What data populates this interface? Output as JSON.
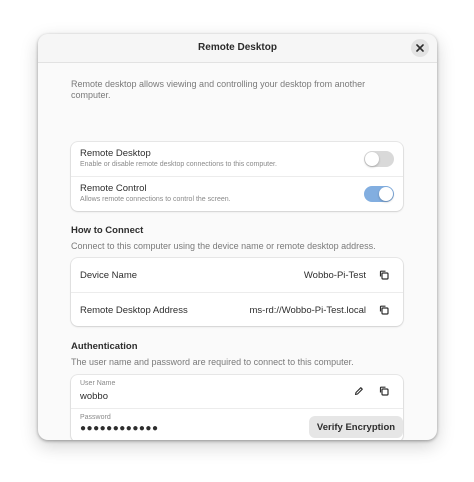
{
  "window": {
    "title": "Remote Desktop"
  },
  "intro": "Remote desktop allows viewing and controlling your desktop from another computer.",
  "toggles": {
    "remote_desktop": {
      "title": "Remote Desktop",
      "subtitle": "Enable or disable remote desktop connections to this computer.",
      "state": "off"
    },
    "remote_control": {
      "title": "Remote Control",
      "subtitle": "Allows remote connections to control the screen.",
      "state": "on"
    }
  },
  "connect": {
    "heading": "How to Connect",
    "description": "Connect to this computer using the device name or remote desktop address.",
    "device_name_label": "Device Name",
    "device_name_value": "Wobbo-Pi-Test",
    "address_label": "Remote Desktop Address",
    "address_value": "ms-rd://Wobbo-Pi-Test.local"
  },
  "auth": {
    "heading": "Authentication",
    "description": "The user name and password are required to connect to this computer.",
    "username_label": "User Name",
    "username_value": "wobbo",
    "password_label": "Password",
    "password_value": "●●●●●●●●●●●●"
  },
  "actions": {
    "verify_label": "Verify Encryption"
  },
  "colors": {
    "switch_on": "#82aee0",
    "switch_off": "#d9d9d9"
  },
  "icons": [
    "close-icon",
    "copy-icon",
    "pencil-icon",
    "eye-icon"
  ]
}
